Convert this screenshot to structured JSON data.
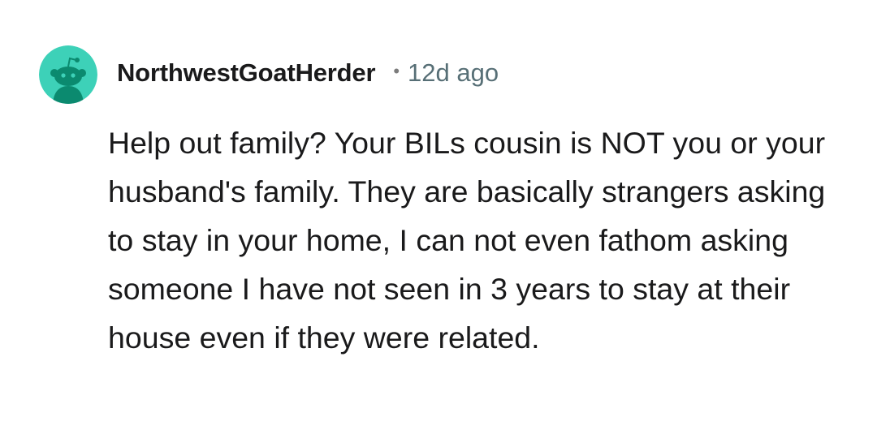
{
  "comment": {
    "avatar_icon": "reddit-snoo-avatar-icon",
    "avatar_color": "#3dd1b8",
    "username": "NorthwestGoatHerder",
    "separator": "•",
    "timestamp": "12d ago",
    "body": "Help out family? Your BILs cousin is NOT you or your husband's family. They are basically strangers asking to stay in your home, I can not even fathom asking someone I have not seen in 3 years to stay at their house even if they were related."
  }
}
